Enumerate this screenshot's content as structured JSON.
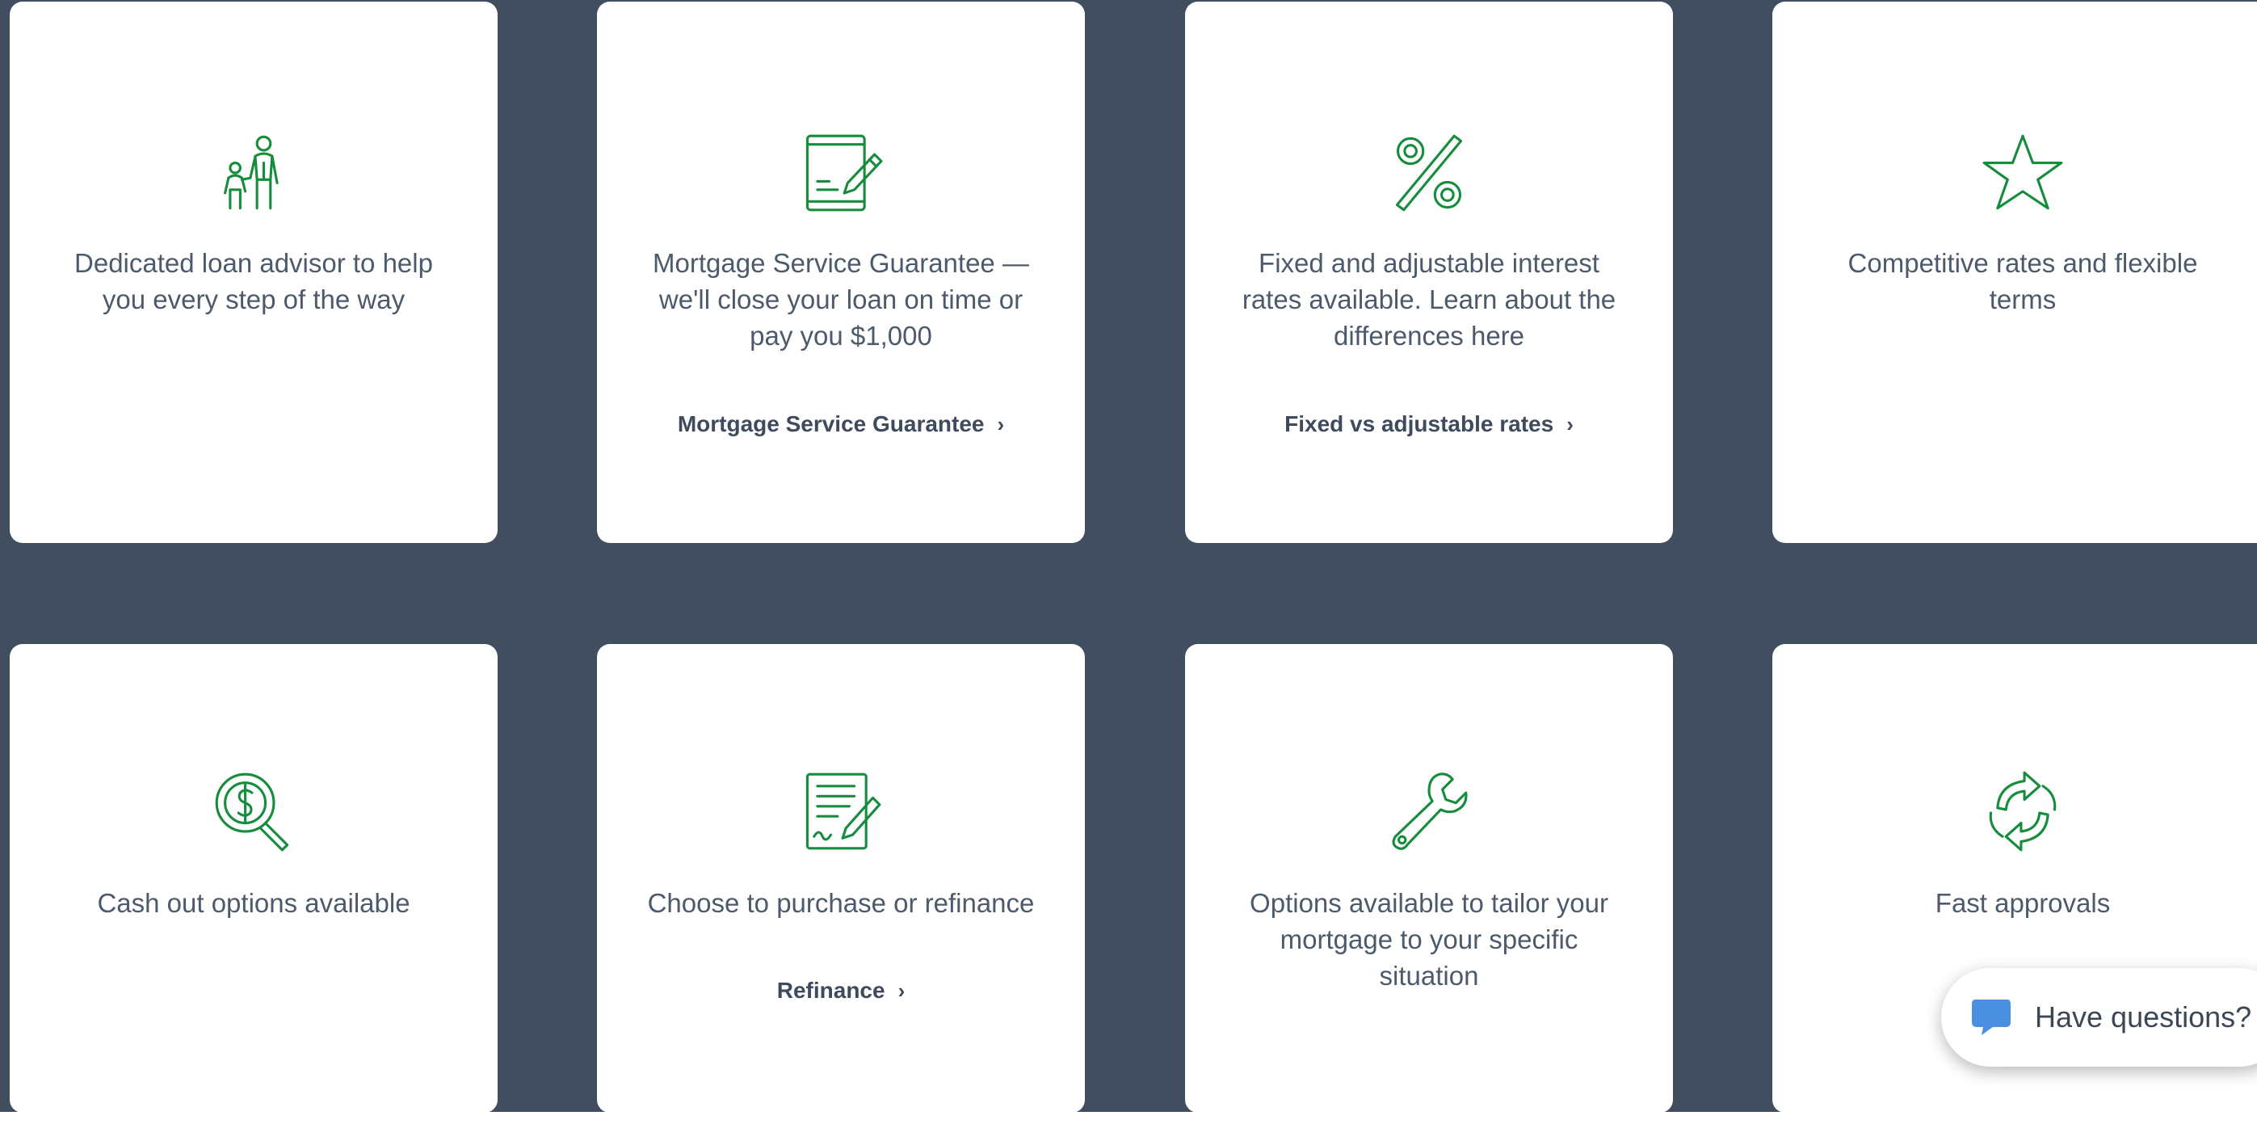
{
  "colors": {
    "background": "#414e5f",
    "card": "#ffffff",
    "icon_green": "#168c3d",
    "text": "#4d5a6b",
    "chat_bubble": "#4a8fe0"
  },
  "cards": [
    {
      "icon": "parent-child-icon",
      "text": "Dedicated loan advisor to help you every step of the way"
    },
    {
      "icon": "document-sign-icon",
      "text": "Mortgage Service Guarantee — we'll close your loan on time or pay you $1,000",
      "link": "Mortgage Service Guarantee"
    },
    {
      "icon": "percent-icon",
      "text": "Fixed and adjustable interest rates available. Learn about the differences here",
      "link": "Fixed vs adjustable rates"
    },
    {
      "icon": "star-icon",
      "text": "Competitive rates and flexible terms"
    },
    {
      "icon": "dollar-search-icon",
      "text": "Cash out options available"
    },
    {
      "icon": "contract-sign-icon",
      "text": "Choose to purchase or refinance",
      "link": "Refinance"
    },
    {
      "icon": "wrench-icon",
      "text": "Options available to tailor your mortgage to your specific situation"
    },
    {
      "icon": "refresh-arrows-icon",
      "text": "Fast approvals"
    }
  ],
  "link_chevron": "›",
  "chat": {
    "icon": "chat-bubble-icon",
    "label": "Have questions?"
  }
}
